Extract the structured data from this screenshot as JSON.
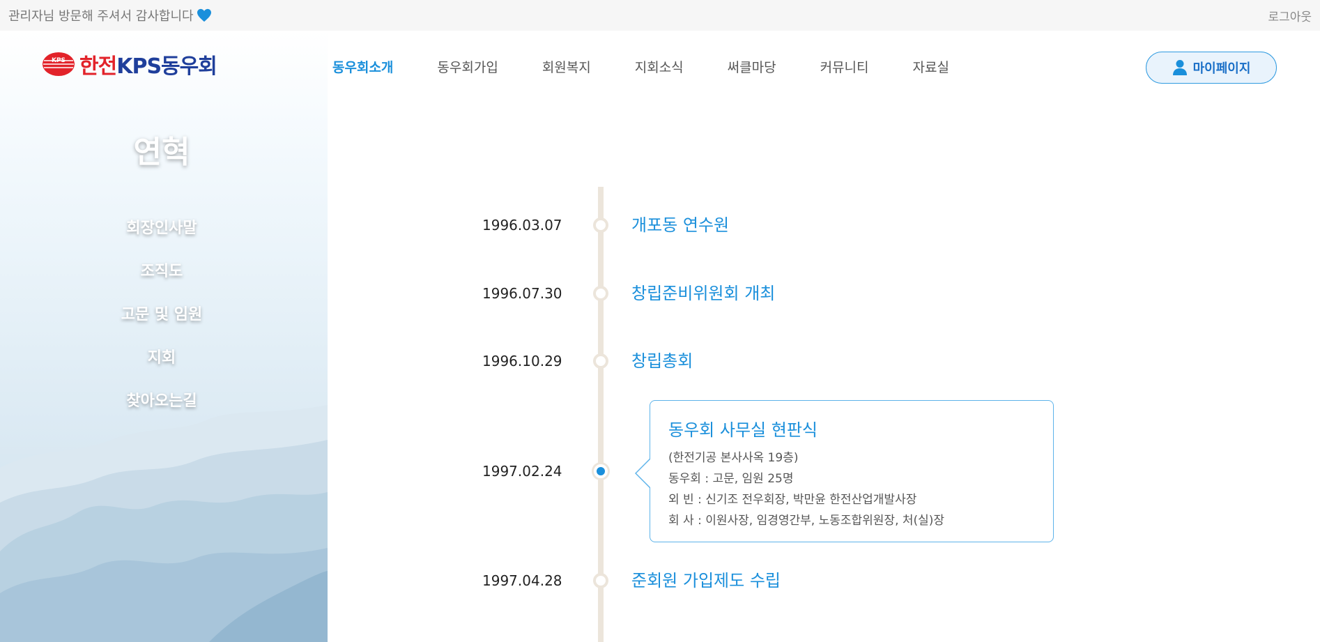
{
  "topbar": {
    "greeting": "관리자님 방문해 주셔서 감사합니다",
    "logout_label": "로그아웃",
    "heart_icon": "heart-icon",
    "heart_color": "#1a8fdb"
  },
  "logo": {
    "emblem_text": "KPS",
    "text_red": "한전",
    "text_blue": "KPS동우회"
  },
  "sidebar": {
    "title": "연혁",
    "items": [
      {
        "label": "회장인사말"
      },
      {
        "label": "조직도"
      },
      {
        "label": "고문 및 임원"
      },
      {
        "label": "지회"
      },
      {
        "label": "찾아오는길"
      }
    ]
  },
  "gnb": {
    "items": [
      {
        "label": "동우회소개",
        "active": true
      },
      {
        "label": "동우회가입"
      },
      {
        "label": "회원복지"
      },
      {
        "label": "지회소식"
      },
      {
        "label": "써클마당"
      },
      {
        "label": "커뮤니티"
      },
      {
        "label": "자료실"
      }
    ]
  },
  "mypage": {
    "label": "마이페이지",
    "icon": "user-icon"
  },
  "timeline": {
    "items": [
      {
        "date": "1996.03.07",
        "title": "개포동 연수원"
      },
      {
        "date": "1996.07.30",
        "title": "창립준비위원회 개최"
      },
      {
        "date": "1996.10.29",
        "title": "창립총회"
      },
      {
        "date": "1997.02.24",
        "title": "동우회 사무실 현판식",
        "details": [
          "(한전기공 본사사옥 19층)",
          "동우회 : 고문, 임원 25명",
          "외 빈 : 신기조 전우회장, 박만윤 한전산업개발사장",
          "회 사 : 이원사장, 임경영간부, 노동조합위원장, 처(실)장"
        ]
      },
      {
        "date": "1997.04.28",
        "title": "준회원 가입제도 수립"
      }
    ]
  },
  "colors": {
    "accent": "#1a8fdb",
    "timeline_line": "#ece5db",
    "card_border": "#5db3ea"
  }
}
